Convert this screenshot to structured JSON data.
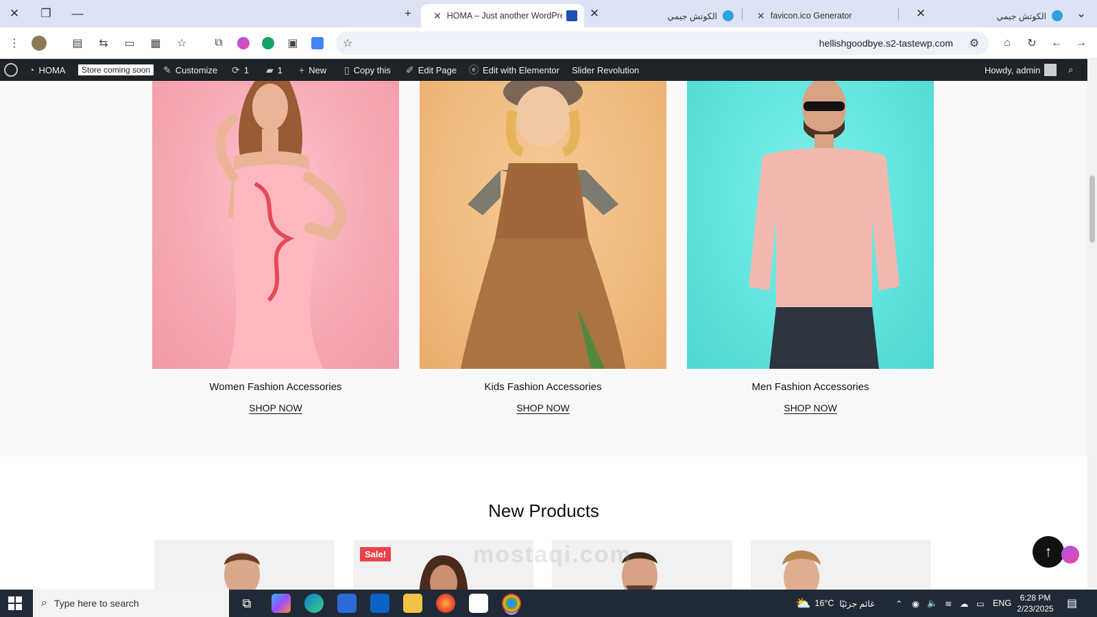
{
  "browser": {
    "tabs": [
      {
        "title": "HOMA – Just another WordPress",
        "active": true
      },
      {
        "title": "الكوتش جيمي",
        "active": false
      },
      {
        "title": "favicon.ico Generator",
        "active": false
      },
      {
        "title": "الكوتش جيمي",
        "active": false
      }
    ],
    "url": "hellishgoodbye.s2-tastewp.com"
  },
  "admin_bar": {
    "site": "HOMA",
    "store_badge": "Store coming soon",
    "customize": "Customize",
    "updates": "1",
    "comments": "1",
    "new": "New",
    "copy": "Copy this",
    "edit_page": "Edit Page",
    "elementor": "Edit with Elementor",
    "slider": "Slider Revolution",
    "howdy": "Howdy, admin"
  },
  "categories": [
    {
      "title": "Women Fashion Accessories",
      "link": "SHOP NOW",
      "bg": "#f7a9b4"
    },
    {
      "title": "Kids Fashion Accessories",
      "link": "SHOP NOW",
      "bg": "#efbb7e"
    },
    {
      "title": "Men Fashion Accessories",
      "link": "SHOP NOW",
      "bg": "#5fe3de"
    }
  ],
  "new_products": {
    "title": "New Products",
    "sale_label": "Sale!"
  },
  "watermark": "mostaqi.com",
  "taskbar": {
    "search_placeholder": "Type here to search",
    "weather_temp": "16°C",
    "weather_text": "غائم جزئيًا",
    "language": "ENG",
    "time": "6:28 PM",
    "date": "2/23/2025"
  }
}
